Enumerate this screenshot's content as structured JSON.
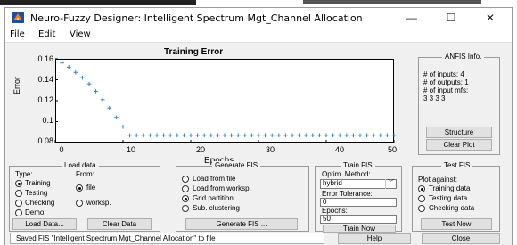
{
  "window": {
    "title": "Neuro-Fuzzy Designer: Intelligent Spectrum Mgt_Channel Allocation",
    "minimize": "—",
    "maximize": "☐",
    "close": "✕"
  },
  "menu": {
    "file": "File",
    "edit": "Edit",
    "view": "View"
  },
  "colors": {
    "series": "#2f7fc1",
    "window_bg": "#f0f0f0"
  },
  "chart_data": {
    "type": "scatter",
    "title": "Training Error",
    "xlabel": "Epochs",
    "ylabel": "Error",
    "xlim": [
      0,
      50
    ],
    "ylim": [
      0.08,
      0.16
    ],
    "xticks": [
      "0",
      "10",
      "20",
      "30",
      "40",
      "50"
    ],
    "yticks": [
      "0.16",
      "0.14",
      "0.12",
      "0.1",
      "0.08"
    ],
    "marker": "+",
    "series": [
      {
        "x": [
          1,
          2,
          3,
          4,
          5,
          6,
          7,
          8,
          9,
          10,
          11,
          12,
          13,
          14,
          15,
          16,
          17,
          18,
          19,
          20,
          21,
          22,
          23,
          24,
          25,
          26,
          27,
          28,
          29,
          30,
          31,
          32,
          33,
          34,
          35,
          36,
          37,
          38,
          39,
          40,
          41,
          42,
          43,
          44,
          45,
          46,
          47,
          48,
          49,
          50
        ],
        "y": [
          0.156,
          0.152,
          0.147,
          0.142,
          0.136,
          0.129,
          0.121,
          0.113,
          0.104,
          0.095,
          0.087,
          0.087,
          0.087,
          0.087,
          0.087,
          0.087,
          0.087,
          0.087,
          0.087,
          0.087,
          0.087,
          0.087,
          0.087,
          0.087,
          0.087,
          0.087,
          0.087,
          0.087,
          0.087,
          0.087,
          0.087,
          0.087,
          0.087,
          0.087,
          0.087,
          0.087,
          0.087,
          0.087,
          0.087,
          0.087,
          0.087,
          0.087,
          0.087,
          0.087,
          0.087,
          0.087,
          0.087,
          0.087,
          0.087,
          0.087
        ]
      }
    ]
  },
  "anfis_info": {
    "title": "ANFIS Info.",
    "inputs": "# of inputs: 4",
    "outputs": "# of outputs: 1",
    "input_mfs": "# of input mfs:",
    "mfs": "3 3 3 3",
    "structure_button": "Structure",
    "clear_plot_button": "Clear Plot"
  },
  "load_data": {
    "title": "Load data",
    "type_label": "Type:",
    "from_label": "From:",
    "types": [
      "Training",
      "Testing",
      "Checking",
      "Demo"
    ],
    "type_selected": 0,
    "from_options": [
      "file",
      "worksp."
    ],
    "from_selected": 0,
    "load_button": "Load Data...",
    "clear_button": "Clear Data"
  },
  "generate_fis": {
    "title": "Generate FIS",
    "options": [
      "Load from file",
      "Load from worksp.",
      "Grid partition",
      "Sub. clustering"
    ],
    "selected": 2,
    "button": "Generate FIS ..."
  },
  "train_fis": {
    "title": "Train FIS",
    "method_label": "Optim. Method:",
    "method_value": "hybrid",
    "tolerance_label": "Error Tolerance:",
    "tolerance_value": "0",
    "epochs_label": "Epochs:",
    "epochs_value": "50",
    "button": "Train Now"
  },
  "test_fis": {
    "title": "Test FIS",
    "plot_against_label": "Plot against:",
    "options": [
      "Training data",
      "Testing data",
      "Checking data"
    ],
    "selected": 0,
    "button": "Test Now"
  },
  "status": {
    "message": "Saved FIS \"Intelligent Spectrum Mgt_Channel Allocation\" to file",
    "help_button": "Help",
    "close_button": "Close"
  }
}
